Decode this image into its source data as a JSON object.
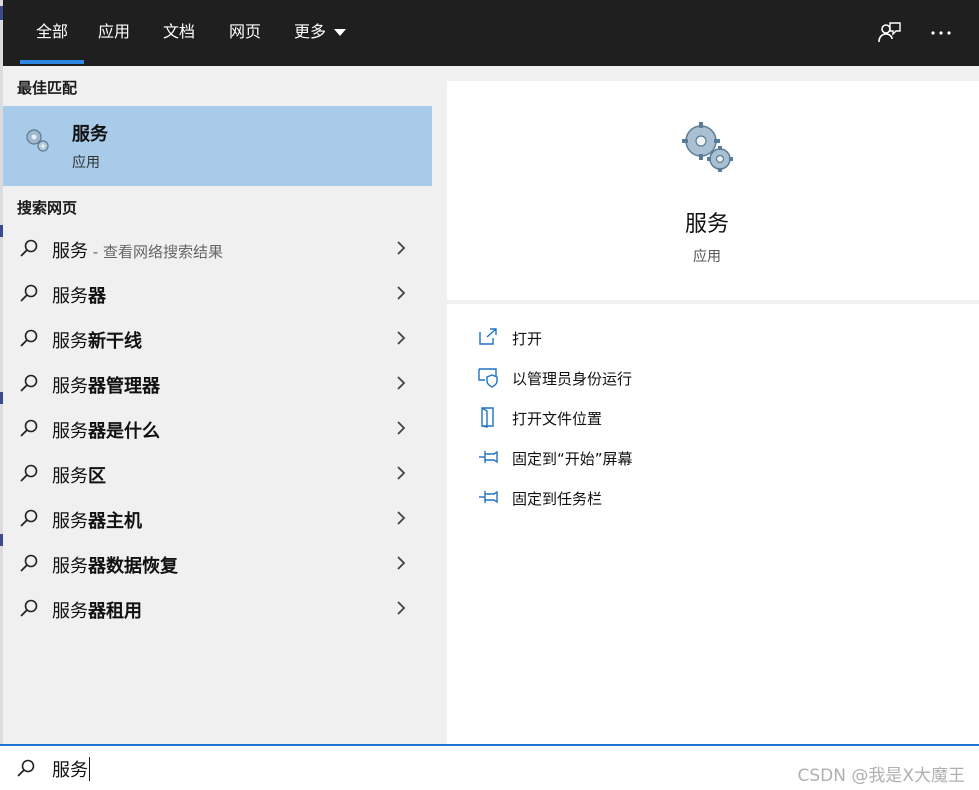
{
  "colors": {
    "topbar": "#1f1f1f",
    "accent": "#2f86e0",
    "selected": "#a8cbea",
    "pane": "#f0f0f0",
    "action_icon": "#1e73c8"
  },
  "topbar": {
    "tabs": [
      {
        "label": "全部",
        "active": true
      },
      {
        "label": "应用"
      },
      {
        "label": "文档"
      },
      {
        "label": "网页"
      },
      {
        "label": "更多"
      }
    ],
    "feedback_icon": "feedback-person-icon",
    "more_icon": "ellipsis-icon"
  },
  "best_match": {
    "heading": "最佳匹配",
    "title": "服务",
    "subtitle": "应用",
    "icon": "gears-icon"
  },
  "web_search": {
    "heading": "搜索网页",
    "items": [
      {
        "prefix": "服务",
        "bold": "",
        "hint": " - 查看网络搜索结果"
      },
      {
        "prefix": "服务",
        "bold": "器",
        "hint": ""
      },
      {
        "prefix": "服务",
        "bold": "新干线",
        "hint": ""
      },
      {
        "prefix": "服务",
        "bold": "器管理器",
        "hint": ""
      },
      {
        "prefix": "服务",
        "bold": "器是什么",
        "hint": ""
      },
      {
        "prefix": "服务",
        "bold": "区",
        "hint": ""
      },
      {
        "prefix": "服务",
        "bold": "器主机",
        "hint": ""
      },
      {
        "prefix": "服务",
        "bold": "器数据恢复",
        "hint": ""
      },
      {
        "prefix": "服务",
        "bold": "器租用",
        "hint": ""
      }
    ]
  },
  "detail": {
    "title": "服务",
    "subtitle": "应用",
    "actions": [
      {
        "label": "打开",
        "icon": "open-icon"
      },
      {
        "label": "以管理员身份运行",
        "icon": "shield-icon"
      },
      {
        "label": "打开文件位置",
        "icon": "file-location-icon"
      },
      {
        "label": "固定到“开始”屏幕",
        "icon": "pin-icon"
      },
      {
        "label": "固定到任务栏",
        "icon": "pin-icon"
      }
    ]
  },
  "search": {
    "value": "服务",
    "watermark": "CSDN @我是X大魔王"
  }
}
